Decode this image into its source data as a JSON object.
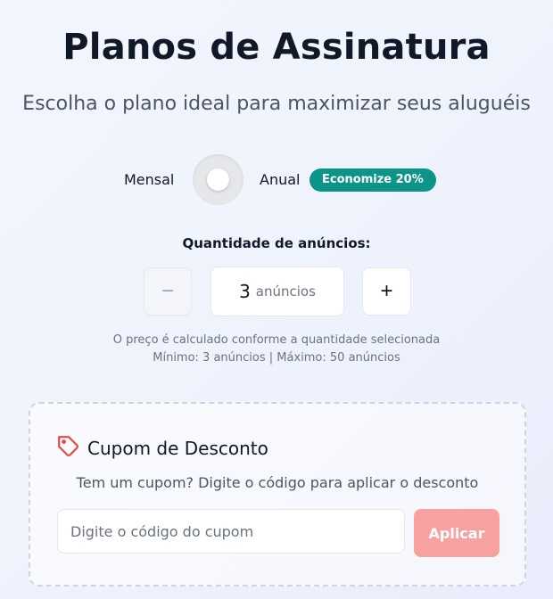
{
  "header": {
    "title": "Planos de Assinatura",
    "subtitle": "Escolha o plano ideal para maximizar seus aluguéis"
  },
  "billing": {
    "monthly_label": "Mensal",
    "annual_label": "Anual",
    "annual_selected": false,
    "savings_badge": "Economize 20%"
  },
  "quantity": {
    "label": "Quantidade de anúncios:",
    "value": "3",
    "unit": "anúncios",
    "decrement_symbol": "−",
    "increment_symbol": "+",
    "note_line1": "O preço é calculado conforme a quantidade selecionada",
    "note_line2": "Mínimo: 3 anúncios | Máximo: 50 anúncios"
  },
  "coupon": {
    "icon": "tag-icon",
    "title": "Cupom de Desconto",
    "description": "Tem um cupom? Digite o código para aplicar o desconto",
    "input_value": "",
    "input_placeholder": "Digite o código do cupom",
    "apply_label": "Aplicar"
  },
  "colors": {
    "accent_teal": "#0d9488",
    "apply_button": "#f8a1a1",
    "tag_icon": "#ef4444"
  }
}
